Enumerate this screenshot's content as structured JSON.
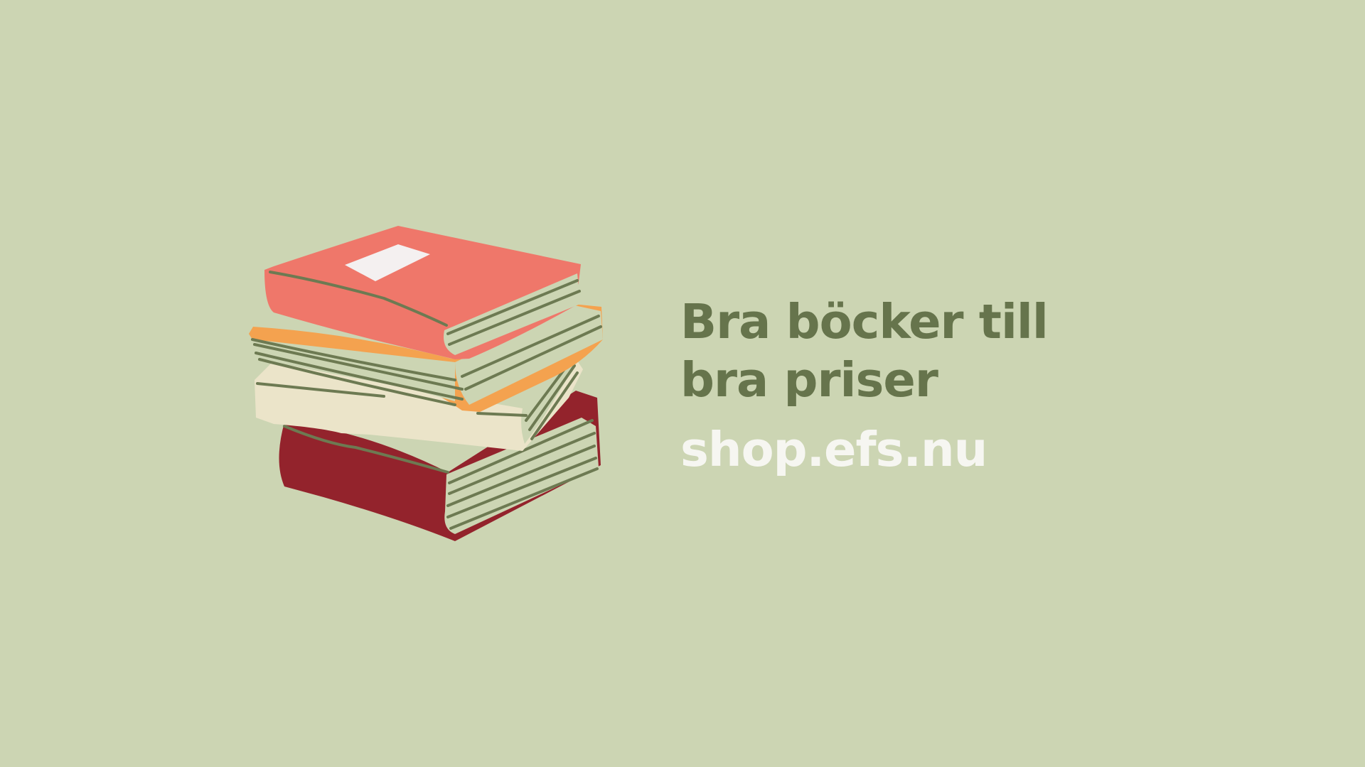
{
  "headline": {
    "line1": "Bra böcker till",
    "line2": "bra priser"
  },
  "url": "shop.efs.nu",
  "illustration": {
    "icon": "book-stack-icon"
  },
  "colors": {
    "background": "#ccd5b3",
    "headline": "#66744c",
    "url": "#f6f6f1",
    "book_coral": "#ef776a",
    "book_orange": "#f4a24f",
    "book_cream": "#ebe4c9",
    "book_maroon": "#93232c",
    "page_lines": "#6d7a52"
  }
}
